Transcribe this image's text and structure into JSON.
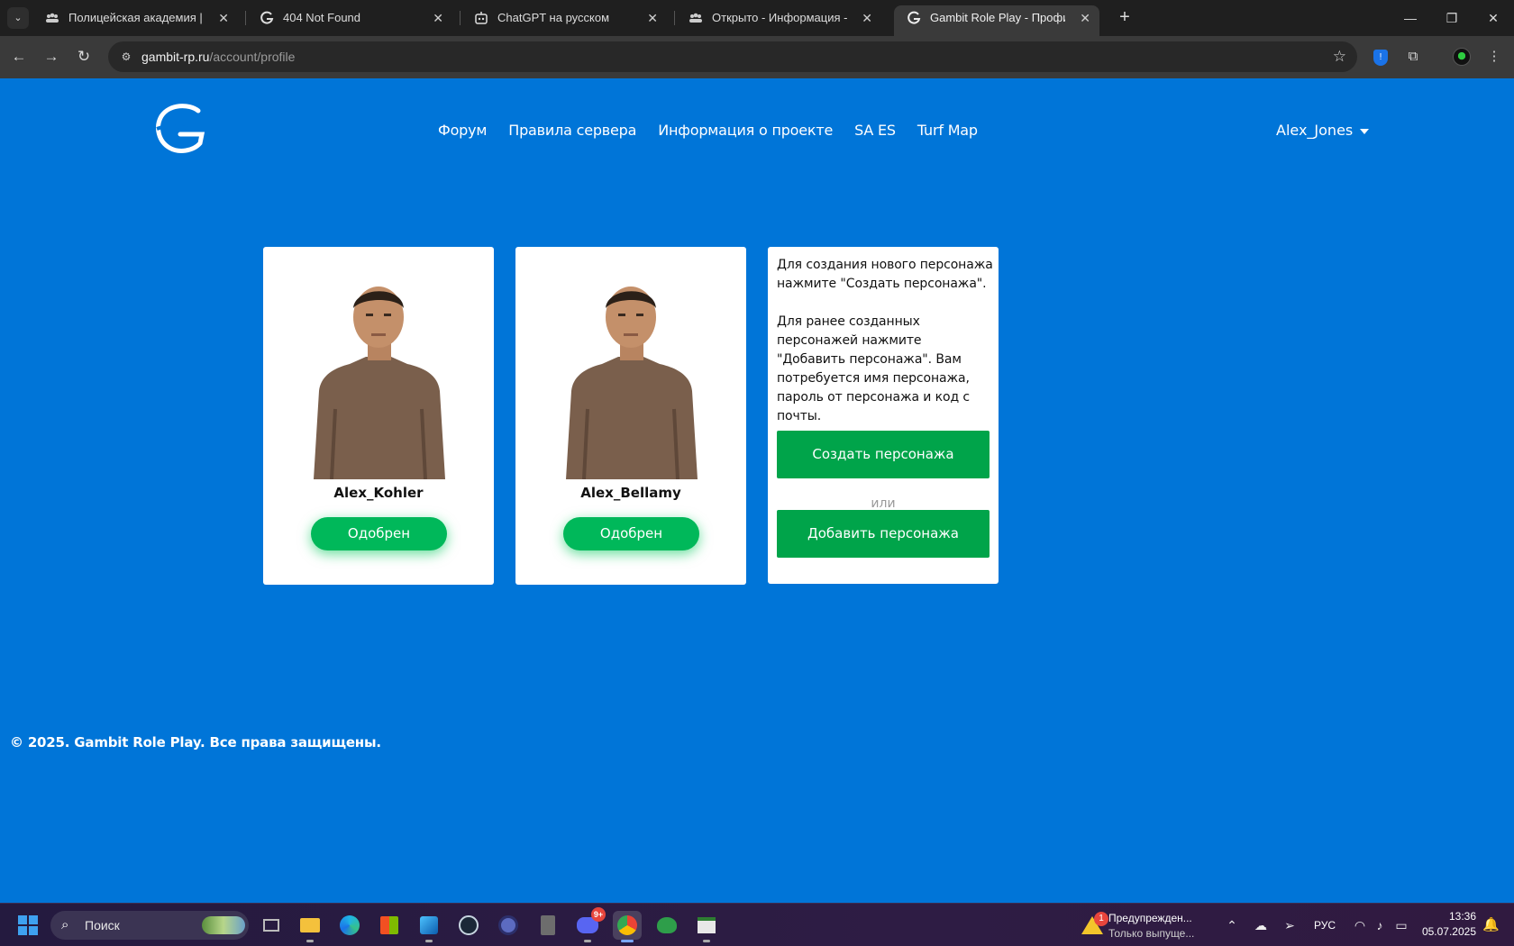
{
  "browser": {
    "tab_menu_icon": "chevron-down-icon",
    "tabs": [
      {
        "title": "Полицейская академия | San A",
        "icon": "community-icon"
      },
      {
        "title": "404 Not Found",
        "icon": "gambit-logo-icon"
      },
      {
        "title": "ChatGPT на русском",
        "icon": "robot-icon"
      },
      {
        "title": "Открыто - Информация - Пол",
        "icon": "community-icon"
      },
      {
        "title": "Gambit Role Play - Профиль UC",
        "icon": "gambit-logo-icon",
        "active": true
      }
    ],
    "new_tab_label": "+",
    "window_controls": {
      "minimize": "—",
      "restore": "❐",
      "close": "✕"
    },
    "url_host": "gambit-rp.ru",
    "url_path": "/account/profile"
  },
  "site": {
    "colors": {
      "background": "#0075d8",
      "button_green": "#00a44a",
      "pill_green": "#00b85a"
    },
    "nav": [
      "Форум",
      "Правила сервера",
      "Информация о проекте",
      "SA ES",
      "Turf Map"
    ],
    "username": "Alex_Jones",
    "characters": [
      {
        "name": "Alex_Kohler",
        "status": "Одобрен"
      },
      {
        "name": "Alex_Bellamy",
        "status": "Одобрен"
      }
    ],
    "info": {
      "paragraph1": "Для создания нового персонажа нажмите \"Создать персонажа\".",
      "paragraph2": "Для ранее созданных персонажей нажмите \"Добавить персонажа\". Вам потребуется имя персонажа, пароль от персонажа и код с почты.",
      "create_button": "Создать персонажа",
      "or": "или",
      "add_button": "Добавить персонажа"
    },
    "footer": "© 2025. Gambit Role Play. Все права защищены."
  },
  "taskbar": {
    "search_placeholder": "Поиск",
    "discord_badge": "9+",
    "notification": {
      "count": "1",
      "title": "Предупрежден...",
      "subtitle": "Только выпуще..."
    },
    "language": "РУС",
    "time": "13:36",
    "date": "05.07.2025"
  }
}
